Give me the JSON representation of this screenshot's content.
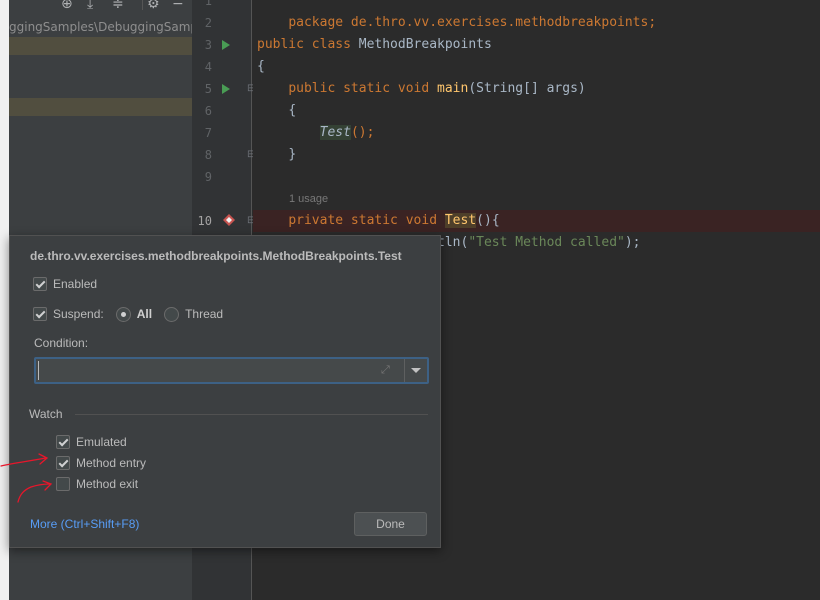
{
  "project_panel": {
    "path": "ggingSamples\\DebuggingSamples"
  },
  "editor": {
    "line_numbers": [
      "1",
      "2",
      "3",
      "4",
      "5",
      "6",
      "7",
      "8",
      "9",
      "10"
    ],
    "package_stmt": "package de.thro.vv.exercises.methodbreakpoints;",
    "class_kw": "public class",
    "class_name": "MethodBreakpoints",
    "open_brace": "{",
    "main_kw": "public static void",
    "main_name": "main",
    "main_params": "(String[] args)",
    "main_open": "{",
    "call_name": "Test",
    "call_rest": "();",
    "main_close": "}",
    "usage_hint": "1 usage",
    "test_kw": "private static void",
    "test_name": "Test",
    "test_rest": "(){",
    "println_prefix": "tln(",
    "println_string": "\"Test Method called\"",
    "println_suffix": ");"
  },
  "breakpoint_popup": {
    "title": "de.thro.vv.exercises.methodbreakpoints.MethodBreakpoints.Test",
    "enabled_label": "Enabled",
    "suspend_label": "Suspend:",
    "all_label": "All",
    "thread_label": "Thread",
    "condition_label": "Condition:",
    "condition_value": "",
    "watch_label": "Watch",
    "emulated_label": "Emulated",
    "method_entry_label": "Method entry",
    "method_exit_label": "Method exit",
    "more_link": "More (Ctrl+Shift+F8)",
    "done_label": "Done",
    "enabled_checked": true,
    "suspend_checked": true,
    "suspend_mode": "All",
    "emulated_checked": true,
    "method_entry_checked": true,
    "method_exit_checked": false
  },
  "colors": {
    "breakpoint": "#c75450",
    "run_gutter": "#499c54",
    "link": "#589df6",
    "annotation": "#e8162b"
  }
}
